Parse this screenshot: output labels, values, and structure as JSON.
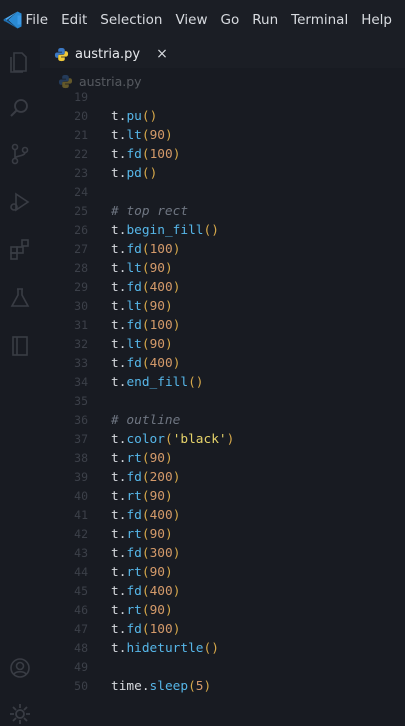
{
  "menu": [
    "File",
    "Edit",
    "Selection",
    "View",
    "Go",
    "Run",
    "Terminal",
    "Help"
  ],
  "tab": {
    "label": "austria.py",
    "close": "×"
  },
  "breadcrumb": {
    "label": "austria.py"
  },
  "colors": {
    "function": "#56b6e8",
    "paren": "#d6a84a",
    "number": "#d49a6a",
    "string": "#e6d36a",
    "comment": "#6f7682"
  },
  "lines": [
    {
      "n": "19",
      "code": []
    },
    {
      "n": "20",
      "code": [
        {
          "t": "var",
          "v": "t"
        },
        {
          "t": "dot",
          "v": "."
        },
        {
          "t": "fn",
          "v": "pu"
        },
        {
          "t": "paren",
          "v": "()"
        }
      ]
    },
    {
      "n": "21",
      "code": [
        {
          "t": "var",
          "v": "t"
        },
        {
          "t": "dot",
          "v": "."
        },
        {
          "t": "fn",
          "v": "lt"
        },
        {
          "t": "paren",
          "v": "("
        },
        {
          "t": "num",
          "v": "90"
        },
        {
          "t": "paren",
          "v": ")"
        }
      ]
    },
    {
      "n": "22",
      "code": [
        {
          "t": "var",
          "v": "t"
        },
        {
          "t": "dot",
          "v": "."
        },
        {
          "t": "fn",
          "v": "fd"
        },
        {
          "t": "paren",
          "v": "("
        },
        {
          "t": "num",
          "v": "100"
        },
        {
          "t": "paren",
          "v": ")"
        }
      ]
    },
    {
      "n": "23",
      "code": [
        {
          "t": "var",
          "v": "t"
        },
        {
          "t": "dot",
          "v": "."
        },
        {
          "t": "fn",
          "v": "pd"
        },
        {
          "t": "paren",
          "v": "()"
        }
      ]
    },
    {
      "n": "24",
      "code": []
    },
    {
      "n": "25",
      "code": [
        {
          "t": "comment",
          "v": "# top rect"
        }
      ]
    },
    {
      "n": "26",
      "code": [
        {
          "t": "var",
          "v": "t"
        },
        {
          "t": "dot",
          "v": "."
        },
        {
          "t": "fn",
          "v": "begin_fill"
        },
        {
          "t": "paren",
          "v": "()"
        }
      ]
    },
    {
      "n": "27",
      "code": [
        {
          "t": "var",
          "v": "t"
        },
        {
          "t": "dot",
          "v": "."
        },
        {
          "t": "fn",
          "v": "fd"
        },
        {
          "t": "paren",
          "v": "("
        },
        {
          "t": "num",
          "v": "100"
        },
        {
          "t": "paren",
          "v": ")"
        }
      ]
    },
    {
      "n": "28",
      "code": [
        {
          "t": "var",
          "v": "t"
        },
        {
          "t": "dot",
          "v": "."
        },
        {
          "t": "fn",
          "v": "lt"
        },
        {
          "t": "paren",
          "v": "("
        },
        {
          "t": "num",
          "v": "90"
        },
        {
          "t": "paren",
          "v": ")"
        }
      ]
    },
    {
      "n": "29",
      "code": [
        {
          "t": "var",
          "v": "t"
        },
        {
          "t": "dot",
          "v": "."
        },
        {
          "t": "fn",
          "v": "fd"
        },
        {
          "t": "paren",
          "v": "("
        },
        {
          "t": "num",
          "v": "400"
        },
        {
          "t": "paren",
          "v": ")"
        }
      ]
    },
    {
      "n": "30",
      "code": [
        {
          "t": "var",
          "v": "t"
        },
        {
          "t": "dot",
          "v": "."
        },
        {
          "t": "fn",
          "v": "lt"
        },
        {
          "t": "paren",
          "v": "("
        },
        {
          "t": "num",
          "v": "90"
        },
        {
          "t": "paren",
          "v": ")"
        }
      ]
    },
    {
      "n": "31",
      "code": [
        {
          "t": "var",
          "v": "t"
        },
        {
          "t": "dot",
          "v": "."
        },
        {
          "t": "fn",
          "v": "fd"
        },
        {
          "t": "paren",
          "v": "("
        },
        {
          "t": "num",
          "v": "100"
        },
        {
          "t": "paren",
          "v": ")"
        }
      ]
    },
    {
      "n": "32",
      "code": [
        {
          "t": "var",
          "v": "t"
        },
        {
          "t": "dot",
          "v": "."
        },
        {
          "t": "fn",
          "v": "lt"
        },
        {
          "t": "paren",
          "v": "("
        },
        {
          "t": "num",
          "v": "90"
        },
        {
          "t": "paren",
          "v": ")"
        }
      ]
    },
    {
      "n": "33",
      "code": [
        {
          "t": "var",
          "v": "t"
        },
        {
          "t": "dot",
          "v": "."
        },
        {
          "t": "fn",
          "v": "fd"
        },
        {
          "t": "paren",
          "v": "("
        },
        {
          "t": "num",
          "v": "400"
        },
        {
          "t": "paren",
          "v": ")"
        }
      ]
    },
    {
      "n": "34",
      "code": [
        {
          "t": "var",
          "v": "t"
        },
        {
          "t": "dot",
          "v": "."
        },
        {
          "t": "fn",
          "v": "end_fill"
        },
        {
          "t": "paren",
          "v": "()"
        }
      ]
    },
    {
      "n": "35",
      "code": []
    },
    {
      "n": "36",
      "code": [
        {
          "t": "comment",
          "v": "# outline"
        }
      ]
    },
    {
      "n": "37",
      "code": [
        {
          "t": "var",
          "v": "t"
        },
        {
          "t": "dot",
          "v": "."
        },
        {
          "t": "fn",
          "v": "color"
        },
        {
          "t": "paren",
          "v": "("
        },
        {
          "t": "str",
          "v": "'black'"
        },
        {
          "t": "paren",
          "v": ")"
        }
      ]
    },
    {
      "n": "38",
      "code": [
        {
          "t": "var",
          "v": "t"
        },
        {
          "t": "dot",
          "v": "."
        },
        {
          "t": "fn",
          "v": "rt"
        },
        {
          "t": "paren",
          "v": "("
        },
        {
          "t": "num",
          "v": "90"
        },
        {
          "t": "paren",
          "v": ")"
        }
      ]
    },
    {
      "n": "39",
      "code": [
        {
          "t": "var",
          "v": "t"
        },
        {
          "t": "dot",
          "v": "."
        },
        {
          "t": "fn",
          "v": "fd"
        },
        {
          "t": "paren",
          "v": "("
        },
        {
          "t": "num",
          "v": "200"
        },
        {
          "t": "paren",
          "v": ")"
        }
      ]
    },
    {
      "n": "40",
      "code": [
        {
          "t": "var",
          "v": "t"
        },
        {
          "t": "dot",
          "v": "."
        },
        {
          "t": "fn",
          "v": "rt"
        },
        {
          "t": "paren",
          "v": "("
        },
        {
          "t": "num",
          "v": "90"
        },
        {
          "t": "paren",
          "v": ")"
        }
      ]
    },
    {
      "n": "41",
      "code": [
        {
          "t": "var",
          "v": "t"
        },
        {
          "t": "dot",
          "v": "."
        },
        {
          "t": "fn",
          "v": "fd"
        },
        {
          "t": "paren",
          "v": "("
        },
        {
          "t": "num",
          "v": "400"
        },
        {
          "t": "paren",
          "v": ")"
        }
      ]
    },
    {
      "n": "42",
      "code": [
        {
          "t": "var",
          "v": "t"
        },
        {
          "t": "dot",
          "v": "."
        },
        {
          "t": "fn",
          "v": "rt"
        },
        {
          "t": "paren",
          "v": "("
        },
        {
          "t": "num",
          "v": "90"
        },
        {
          "t": "paren",
          "v": ")"
        }
      ]
    },
    {
      "n": "43",
      "code": [
        {
          "t": "var",
          "v": "t"
        },
        {
          "t": "dot",
          "v": "."
        },
        {
          "t": "fn",
          "v": "fd"
        },
        {
          "t": "paren",
          "v": "("
        },
        {
          "t": "num",
          "v": "300"
        },
        {
          "t": "paren",
          "v": ")"
        }
      ]
    },
    {
      "n": "44",
      "code": [
        {
          "t": "var",
          "v": "t"
        },
        {
          "t": "dot",
          "v": "."
        },
        {
          "t": "fn",
          "v": "rt"
        },
        {
          "t": "paren",
          "v": "("
        },
        {
          "t": "num",
          "v": "90"
        },
        {
          "t": "paren",
          "v": ")"
        }
      ]
    },
    {
      "n": "45",
      "code": [
        {
          "t": "var",
          "v": "t"
        },
        {
          "t": "dot",
          "v": "."
        },
        {
          "t": "fn",
          "v": "fd"
        },
        {
          "t": "paren",
          "v": "("
        },
        {
          "t": "num",
          "v": "400"
        },
        {
          "t": "paren",
          "v": ")"
        }
      ]
    },
    {
      "n": "46",
      "code": [
        {
          "t": "var",
          "v": "t"
        },
        {
          "t": "dot",
          "v": "."
        },
        {
          "t": "fn",
          "v": "rt"
        },
        {
          "t": "paren",
          "v": "("
        },
        {
          "t": "num",
          "v": "90"
        },
        {
          "t": "paren",
          "v": ")"
        }
      ]
    },
    {
      "n": "47",
      "code": [
        {
          "t": "var",
          "v": "t"
        },
        {
          "t": "dot",
          "v": "."
        },
        {
          "t": "fn",
          "v": "fd"
        },
        {
          "t": "paren",
          "v": "("
        },
        {
          "t": "num",
          "v": "100"
        },
        {
          "t": "paren",
          "v": ")"
        }
      ]
    },
    {
      "n": "48",
      "code": [
        {
          "t": "var",
          "v": "t"
        },
        {
          "t": "dot",
          "v": "."
        },
        {
          "t": "fn",
          "v": "hideturtle"
        },
        {
          "t": "paren",
          "v": "()"
        }
      ]
    },
    {
      "n": "49",
      "code": []
    },
    {
      "n": "50",
      "code": [
        {
          "t": "var",
          "v": "time"
        },
        {
          "t": "dot",
          "v": "."
        },
        {
          "t": "fn",
          "v": "sleep"
        },
        {
          "t": "paren",
          "v": "("
        },
        {
          "t": "num",
          "v": "5"
        },
        {
          "t": "paren",
          "v": ")"
        }
      ]
    }
  ]
}
